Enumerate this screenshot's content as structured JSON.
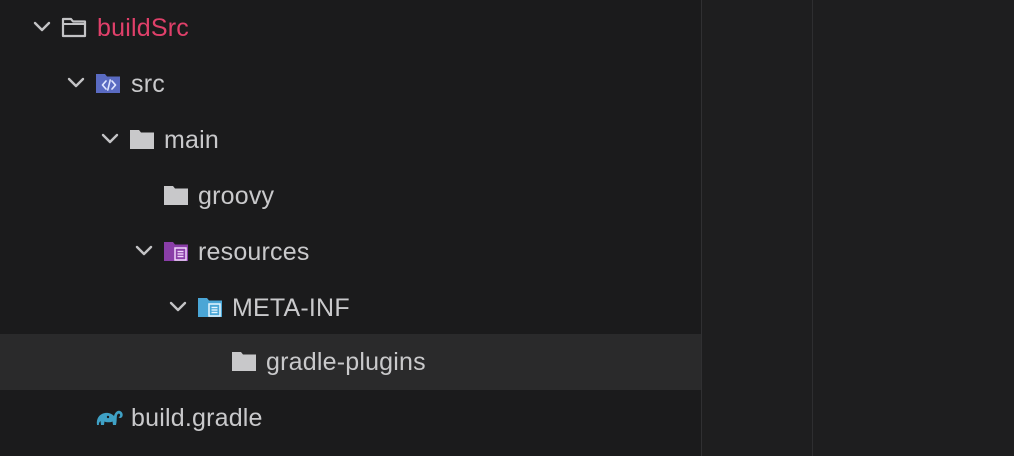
{
  "tree": {
    "items": [
      {
        "label": "buildSrc",
        "expanded": true,
        "icon": "folder-outline-icon"
      },
      {
        "label": "src",
        "expanded": true,
        "icon": "source-folder-icon"
      },
      {
        "label": "main",
        "expanded": true,
        "icon": "folder-icon"
      },
      {
        "label": "groovy",
        "expanded": false,
        "icon": "folder-icon"
      },
      {
        "label": "resources",
        "expanded": true,
        "icon": "resources-folder-icon"
      },
      {
        "label": "META-INF",
        "expanded": true,
        "icon": "meta-inf-folder-icon"
      },
      {
        "label": "gradle-plugins",
        "expanded": false,
        "icon": "folder-icon",
        "selected": true
      },
      {
        "label": "build.gradle",
        "expanded": false,
        "icon": "gradle-elephant-icon"
      }
    ]
  },
  "colors": {
    "root_label": "#e0406a",
    "label": "#c9c9cb",
    "source_folder": "#5a6bc2",
    "resources_folder": "#8a3ea8",
    "meta_inf_folder": "#4aa6d6",
    "gradle": "#3fa1c5"
  }
}
